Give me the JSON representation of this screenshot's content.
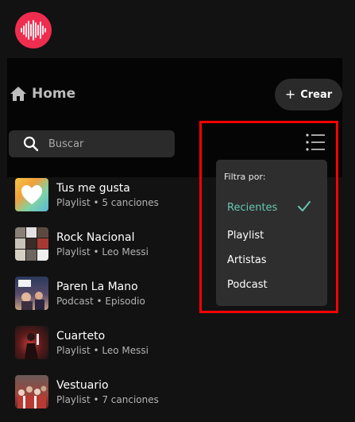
{
  "header": {
    "logo_icon": "sound-wave-icon",
    "home_label": "Home",
    "create_label": "Crear"
  },
  "search": {
    "placeholder": "Buscar"
  },
  "filter_menu": {
    "title": "Filtra por:",
    "options": [
      {
        "label": "Recientes",
        "selected": true
      },
      {
        "label": "Playlist",
        "selected": false
      },
      {
        "label": "Artistas",
        "selected": false
      },
      {
        "label": "Podcast",
        "selected": false
      }
    ]
  },
  "library": {
    "items": [
      {
        "title": "Tus me gusta",
        "subtitle": "Playlist • 5 canciones"
      },
      {
        "title": "Rock Nacional",
        "subtitle": "Playlist • Leo Messi"
      },
      {
        "title": "Paren La Mano",
        "subtitle": "Podcast • Episodio"
      },
      {
        "title": "Cuarteto",
        "subtitle": "Playlist • Leo Messi"
      },
      {
        "title": "Vestuario",
        "subtitle": "Playlist • 7 canciones"
      }
    ]
  },
  "colors": {
    "brand": "#ef2d4f",
    "accent_selected": "#66c7b0",
    "highlight_box": "#ff0000"
  }
}
